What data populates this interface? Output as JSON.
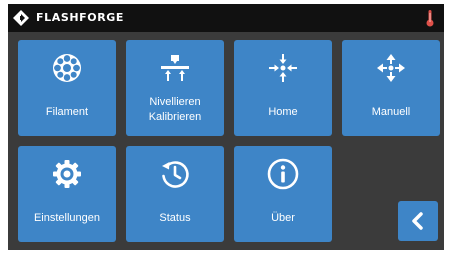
{
  "header": {
    "brand": "FLASHFORGE",
    "logo_icon": "flashforge-logo-icon",
    "status_icon": "thermometer-icon"
  },
  "menu": {
    "filament": {
      "label": "Filament",
      "icon": "filament-spool-icon"
    },
    "leveling": {
      "label_line1": "Nivellieren",
      "label_line2": "Kalibrieren",
      "icon": "bed-leveling-icon"
    },
    "home": {
      "label": "Home",
      "icon": "home-arrows-icon"
    },
    "manual": {
      "label": "Manuell",
      "icon": "move-arrows-icon"
    },
    "settings": {
      "label": "Einstellungen",
      "icon": "gear-icon"
    },
    "status": {
      "label": "Status",
      "icon": "clock-history-icon"
    },
    "about": {
      "label": "Über",
      "icon": "info-icon"
    }
  },
  "back_button": {
    "icon": "chevron-left-icon"
  },
  "colors": {
    "tile": "#3e85c7",
    "background": "#3b3b3b",
    "topbar": "#111111",
    "thermometer": "#e0514a"
  }
}
